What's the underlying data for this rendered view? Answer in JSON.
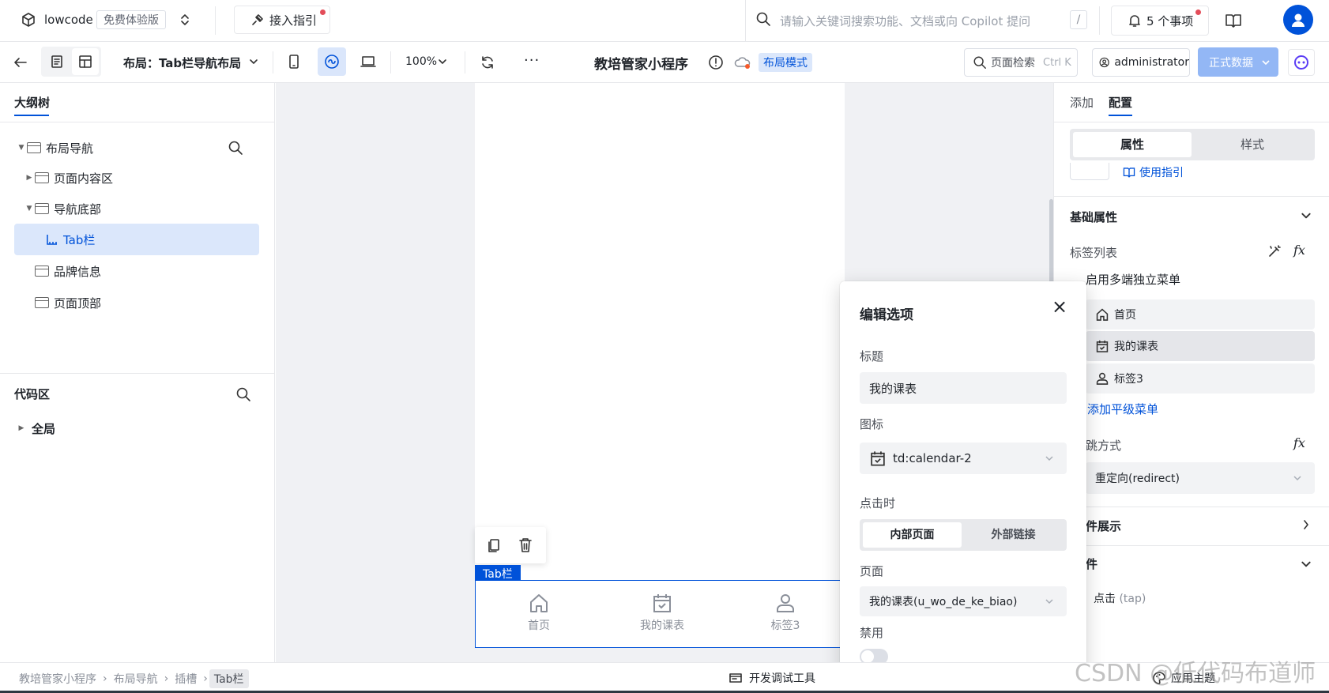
{
  "topbar": {
    "app_name": "lowcode",
    "edition_badge": "免费体验版",
    "guide_label": "接入指引",
    "search_placeholder": "请输入关键词搜索功能、文档或向 Copilot 提问",
    "search_shortcut": "/",
    "todo_label": "5 个事项"
  },
  "toolbar": {
    "layout_label": "布局：Tab栏导航布局",
    "zoom": "100%",
    "more": "···",
    "page_title": "教培管家小程序",
    "mode_badge": "布局模式",
    "page_search_label": "页面检索",
    "page_search_shortcut": "Ctrl K",
    "user_label": "administrator",
    "data_button": "正式数据"
  },
  "left": {
    "outline_tab": "大纲树",
    "tree": [
      {
        "label": "布局导航",
        "caret": "▼"
      },
      {
        "label": "页面内容区",
        "caret": "▶"
      },
      {
        "label": "导航底部",
        "caret": "▼"
      },
      {
        "label": "Tab栏",
        "caret": ""
      },
      {
        "label": "品牌信息",
        "caret": ""
      },
      {
        "label": "页面顶部",
        "caret": ""
      }
    ],
    "code_title": "代码区",
    "code_tree": [
      {
        "label": "全局",
        "caret": "▶"
      }
    ]
  },
  "canvas": {
    "tag": "Tab栏",
    "tabs": [
      {
        "label": "首页",
        "icon": "home-icon"
      },
      {
        "label": "我的课表",
        "icon": "calendar-icon"
      },
      {
        "label": "标签3",
        "icon": "user-icon"
      }
    ]
  },
  "right": {
    "tabs": [
      "添加",
      "配置"
    ],
    "subtabs": [
      "属性",
      "样式"
    ],
    "guide_link": "使用指引",
    "section_basic": "基础属性",
    "tab_list_label": "标签列表",
    "fx": "fx",
    "multi_menu_label": "启用多端独立菜单",
    "options": [
      "首页",
      "我的课表",
      "标签3"
    ],
    "add_menu": "添加平级菜单",
    "jump_label": "跳方式",
    "jump_value": "重定向(redirect)",
    "section_cond": "件展示",
    "section_event": "件",
    "event_item": "点击",
    "event_item_sub": "(tap)"
  },
  "popup": {
    "title": "编辑选项",
    "close": "×",
    "title_label": "标题",
    "title_value": "我的课表",
    "icon_label": "图标",
    "icon_value": "td:calendar-2",
    "click_label": "点击时",
    "seg_internal": "内部页面",
    "seg_external": "外部链接",
    "page_label": "页面",
    "page_value": "我的课表(u_wo_de_ke_biao)",
    "disabled_label": "禁用"
  },
  "status": {
    "breadcrumb": [
      "教培管家小程序",
      "布局导航",
      "插槽",
      "Tab栏"
    ],
    "dev_tools": "开发调试工具",
    "theme": "应用主题",
    "watermark": "CSDN @低代码布道师"
  },
  "colors": {
    "brand": "#0052d9",
    "selected_bg": "#dbe7fb",
    "canvas_bg": "#f0f1f4",
    "data_button_bg": "#93b7f5",
    "alert_red": "#e34d59"
  }
}
